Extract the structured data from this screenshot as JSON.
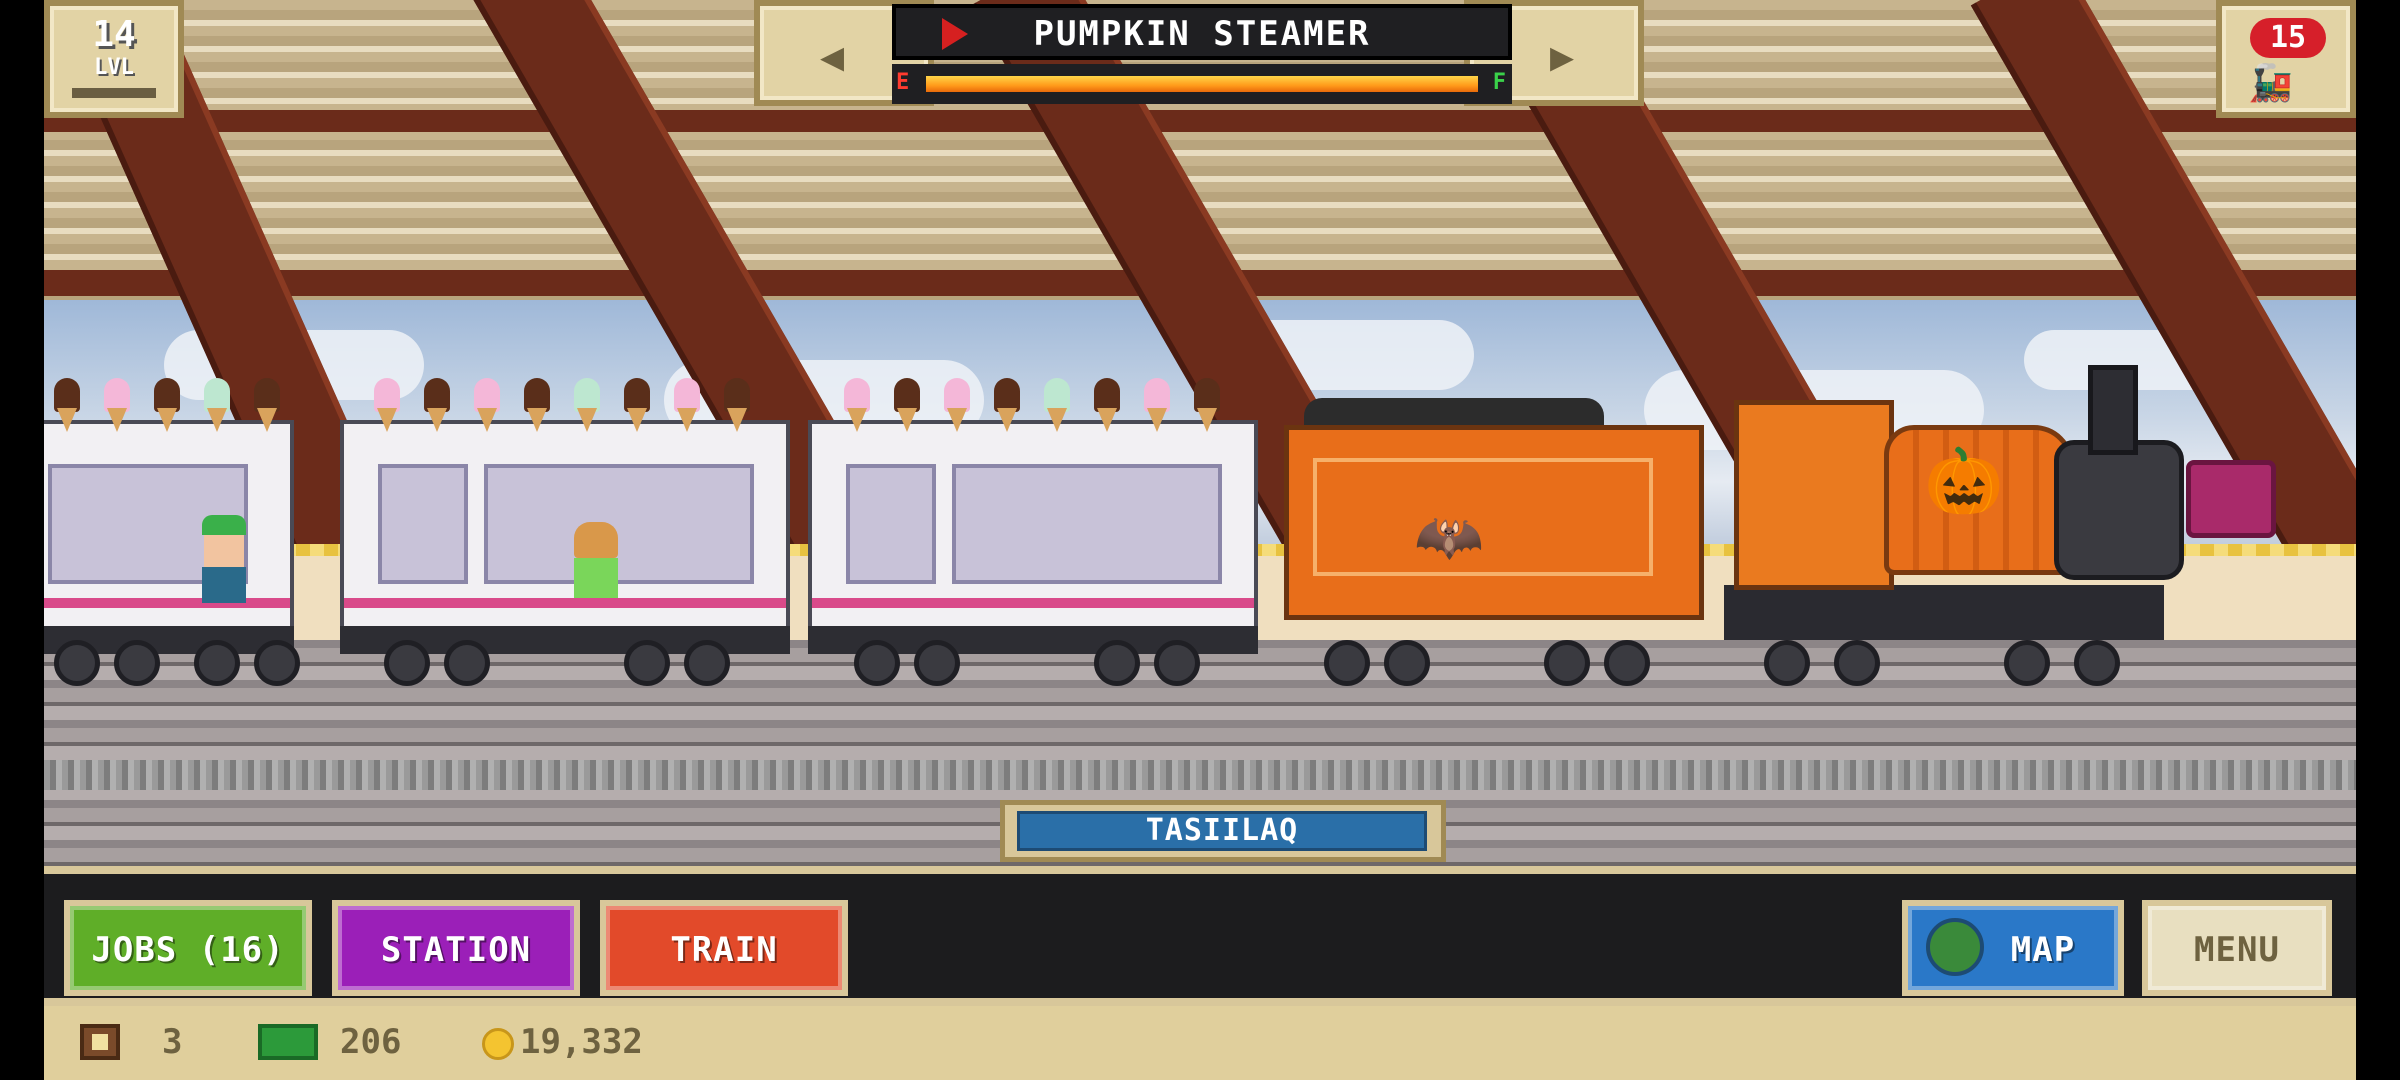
{
  "game": {
    "level": {
      "number": "14",
      "label": "LVL"
    },
    "train_selector": {
      "name": "PUMPKIN STEAMER",
      "fuel_empty_label": "E",
      "fuel_full_label": "F",
      "fuel_level_percent": 100
    },
    "tickets": {
      "count": "15",
      "icon": "ticket-train-icon"
    },
    "station_name": "TASIILAQ",
    "toolbar": {
      "jobs_label": "JOBS (16)",
      "station_label": "STATION",
      "train_label": "TRAIN",
      "map_label": "MAP",
      "menu_label": "MENU"
    },
    "status": {
      "crates": "3",
      "cash": "206",
      "coins": "19,332"
    },
    "colors": {
      "jobs": "#5fae28",
      "station": "#9b1fb8",
      "train": "#e24a2a",
      "map": "#2a78c8",
      "fuel": "#ff9a1a"
    }
  }
}
